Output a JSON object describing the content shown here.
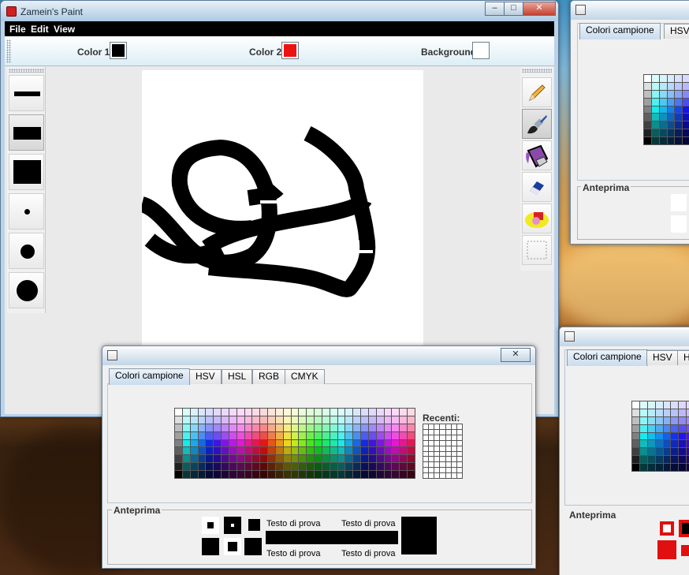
{
  "window": {
    "title": "Zamein's Paint",
    "minimize": "–",
    "maximize": "□",
    "close": "✕"
  },
  "menu": [
    {
      "label": "File"
    },
    {
      "label": "Edit"
    },
    {
      "label": "View"
    }
  ],
  "colors": {
    "color1": {
      "label": "Color 1",
      "value": "#000000"
    },
    "color2": {
      "label": "Color 2",
      "value": "#ee1111"
    },
    "background": {
      "label": "Background",
      "value": "#ffffff"
    }
  },
  "left_tools": [
    "thin-line-size",
    "medium-line-size",
    "thick-line-size",
    "small-dot-size",
    "medium-dot-size",
    "large-dot-size"
  ],
  "right_tools": [
    {
      "name": "pencil-icon"
    },
    {
      "name": "brush-icon"
    },
    {
      "name": "paint-bucket-icon"
    },
    {
      "name": "eraser-icon"
    },
    {
      "name": "shapes-icon"
    },
    {
      "name": "selection-icon"
    }
  ],
  "color_chooser": {
    "close": "✕",
    "tabs": [
      {
        "label": "Colori campione"
      },
      {
        "label": "HSV"
      },
      {
        "label": "HSL"
      },
      {
        "label": "RGB"
      },
      {
        "label": "CMYK"
      }
    ],
    "recent_label": "Recenti:",
    "preview_label": "Anteprima",
    "sample_text": "Testo di prova"
  },
  "color_chooser_right_top": {
    "tabs": [
      {
        "label": "Colori campione"
      },
      {
        "label": "HSV"
      }
    ],
    "preview_label": "Anteprima"
  },
  "color_chooser_right_bottom": {
    "tabs": [
      {
        "label": "Colori campione"
      },
      {
        "label": "HSV"
      },
      {
        "label": "H"
      }
    ],
    "preview_label": "Anteprima"
  }
}
